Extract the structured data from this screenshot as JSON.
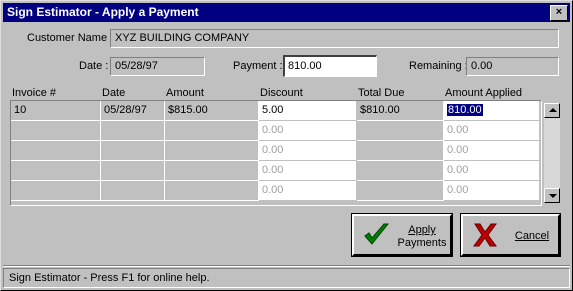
{
  "window": {
    "title": "Sign Estimator - Apply a Payment",
    "close_glyph": "×"
  },
  "customer": {
    "label": "Customer Name :",
    "value": "XYZ BUILDING COMPANY"
  },
  "date": {
    "label": "Date :",
    "value": "05/28/97"
  },
  "payment": {
    "label": "Payment :",
    "value": "810.00"
  },
  "remaining": {
    "label": "Remaining :",
    "value": "0.00"
  },
  "grid": {
    "headers": [
      "Invoice #",
      "Date",
      "Amount",
      "Discount",
      "Total Due",
      "Amount Applied"
    ],
    "rows": [
      [
        "10",
        "05/28/97",
        "$815.00",
        "5.00",
        "$810.00",
        "810.00"
      ],
      [
        "",
        "",
        "",
        "0.00",
        "",
        "0.00"
      ],
      [
        "",
        "",
        "",
        "0.00",
        "",
        "0.00"
      ],
      [
        "",
        "",
        "",
        "0.00",
        "",
        "0.00"
      ],
      [
        "",
        "",
        "",
        "0.00",
        "",
        "0.00"
      ]
    ]
  },
  "buttons": {
    "apply_line1": "Apply",
    "apply_line2": "Payments",
    "cancel": "Cancel"
  },
  "icons": {
    "apply": "checkmark-icon",
    "cancel": "x-icon"
  },
  "colors": {
    "titlebar": "#000080",
    "check": "#008000",
    "cross": "#c00000"
  },
  "status": "Sign Estimator - Press F1 for online help."
}
